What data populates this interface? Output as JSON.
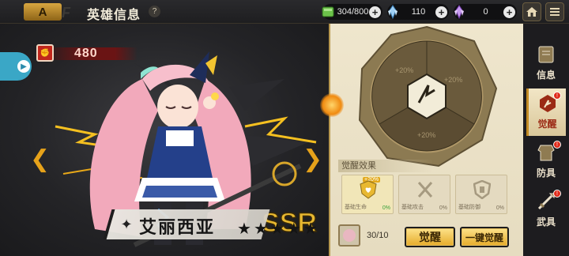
{
  "header": {
    "title": "英雄信息",
    "help_glyph": "?",
    "back_glyph": "A"
  },
  "resources": [
    {
      "icon": "green-gem-icon",
      "value": "304/800",
      "plus": "+"
    },
    {
      "icon": "blue-crystal-icon",
      "value": "110",
      "plus": "+"
    },
    {
      "icon": "purple-crystal-icon",
      "value": "0",
      "plus": "+"
    }
  ],
  "hero": {
    "power": "480",
    "name": "艾丽西亚",
    "rarity": "SSR",
    "stars_total": 5,
    "star_glyph": "★"
  },
  "panel": {
    "section_label": "觉醒效果",
    "bonuses": [
      {
        "icon": "shield-heart-icon",
        "label": "基础生命",
        "percent": "0%",
        "highlight": "+20%",
        "active": true
      },
      {
        "icon": "crossed-swords-icon",
        "label": "基础攻击",
        "percent": "0%"
      },
      {
        "icon": "armor-shield-icon",
        "label": "基础防御",
        "percent": "0%"
      }
    ],
    "wheel_segments": [
      "+20%",
      "+20%",
      "+20%"
    ],
    "shard_count": "30/10",
    "awaken_label": "觉醒",
    "quick_awaken_label": "一键觉醒"
  },
  "tabs": [
    {
      "label": "信息",
      "icon": "book-icon",
      "active": false
    },
    {
      "label": "觉醒",
      "icon": "awaken-emblem-icon",
      "active": true,
      "badge": "!"
    },
    {
      "label": "防具",
      "icon": "armor-icon",
      "active": false,
      "badge": "!"
    },
    {
      "label": "武具",
      "icon": "weapon-icon",
      "active": false,
      "badge": "!"
    }
  ],
  "colors": {
    "accent_gold": "#e6a21a",
    "panel_bg": "#efe6cd",
    "power_red": "#c0261c",
    "active_green": "#3aa03a"
  }
}
